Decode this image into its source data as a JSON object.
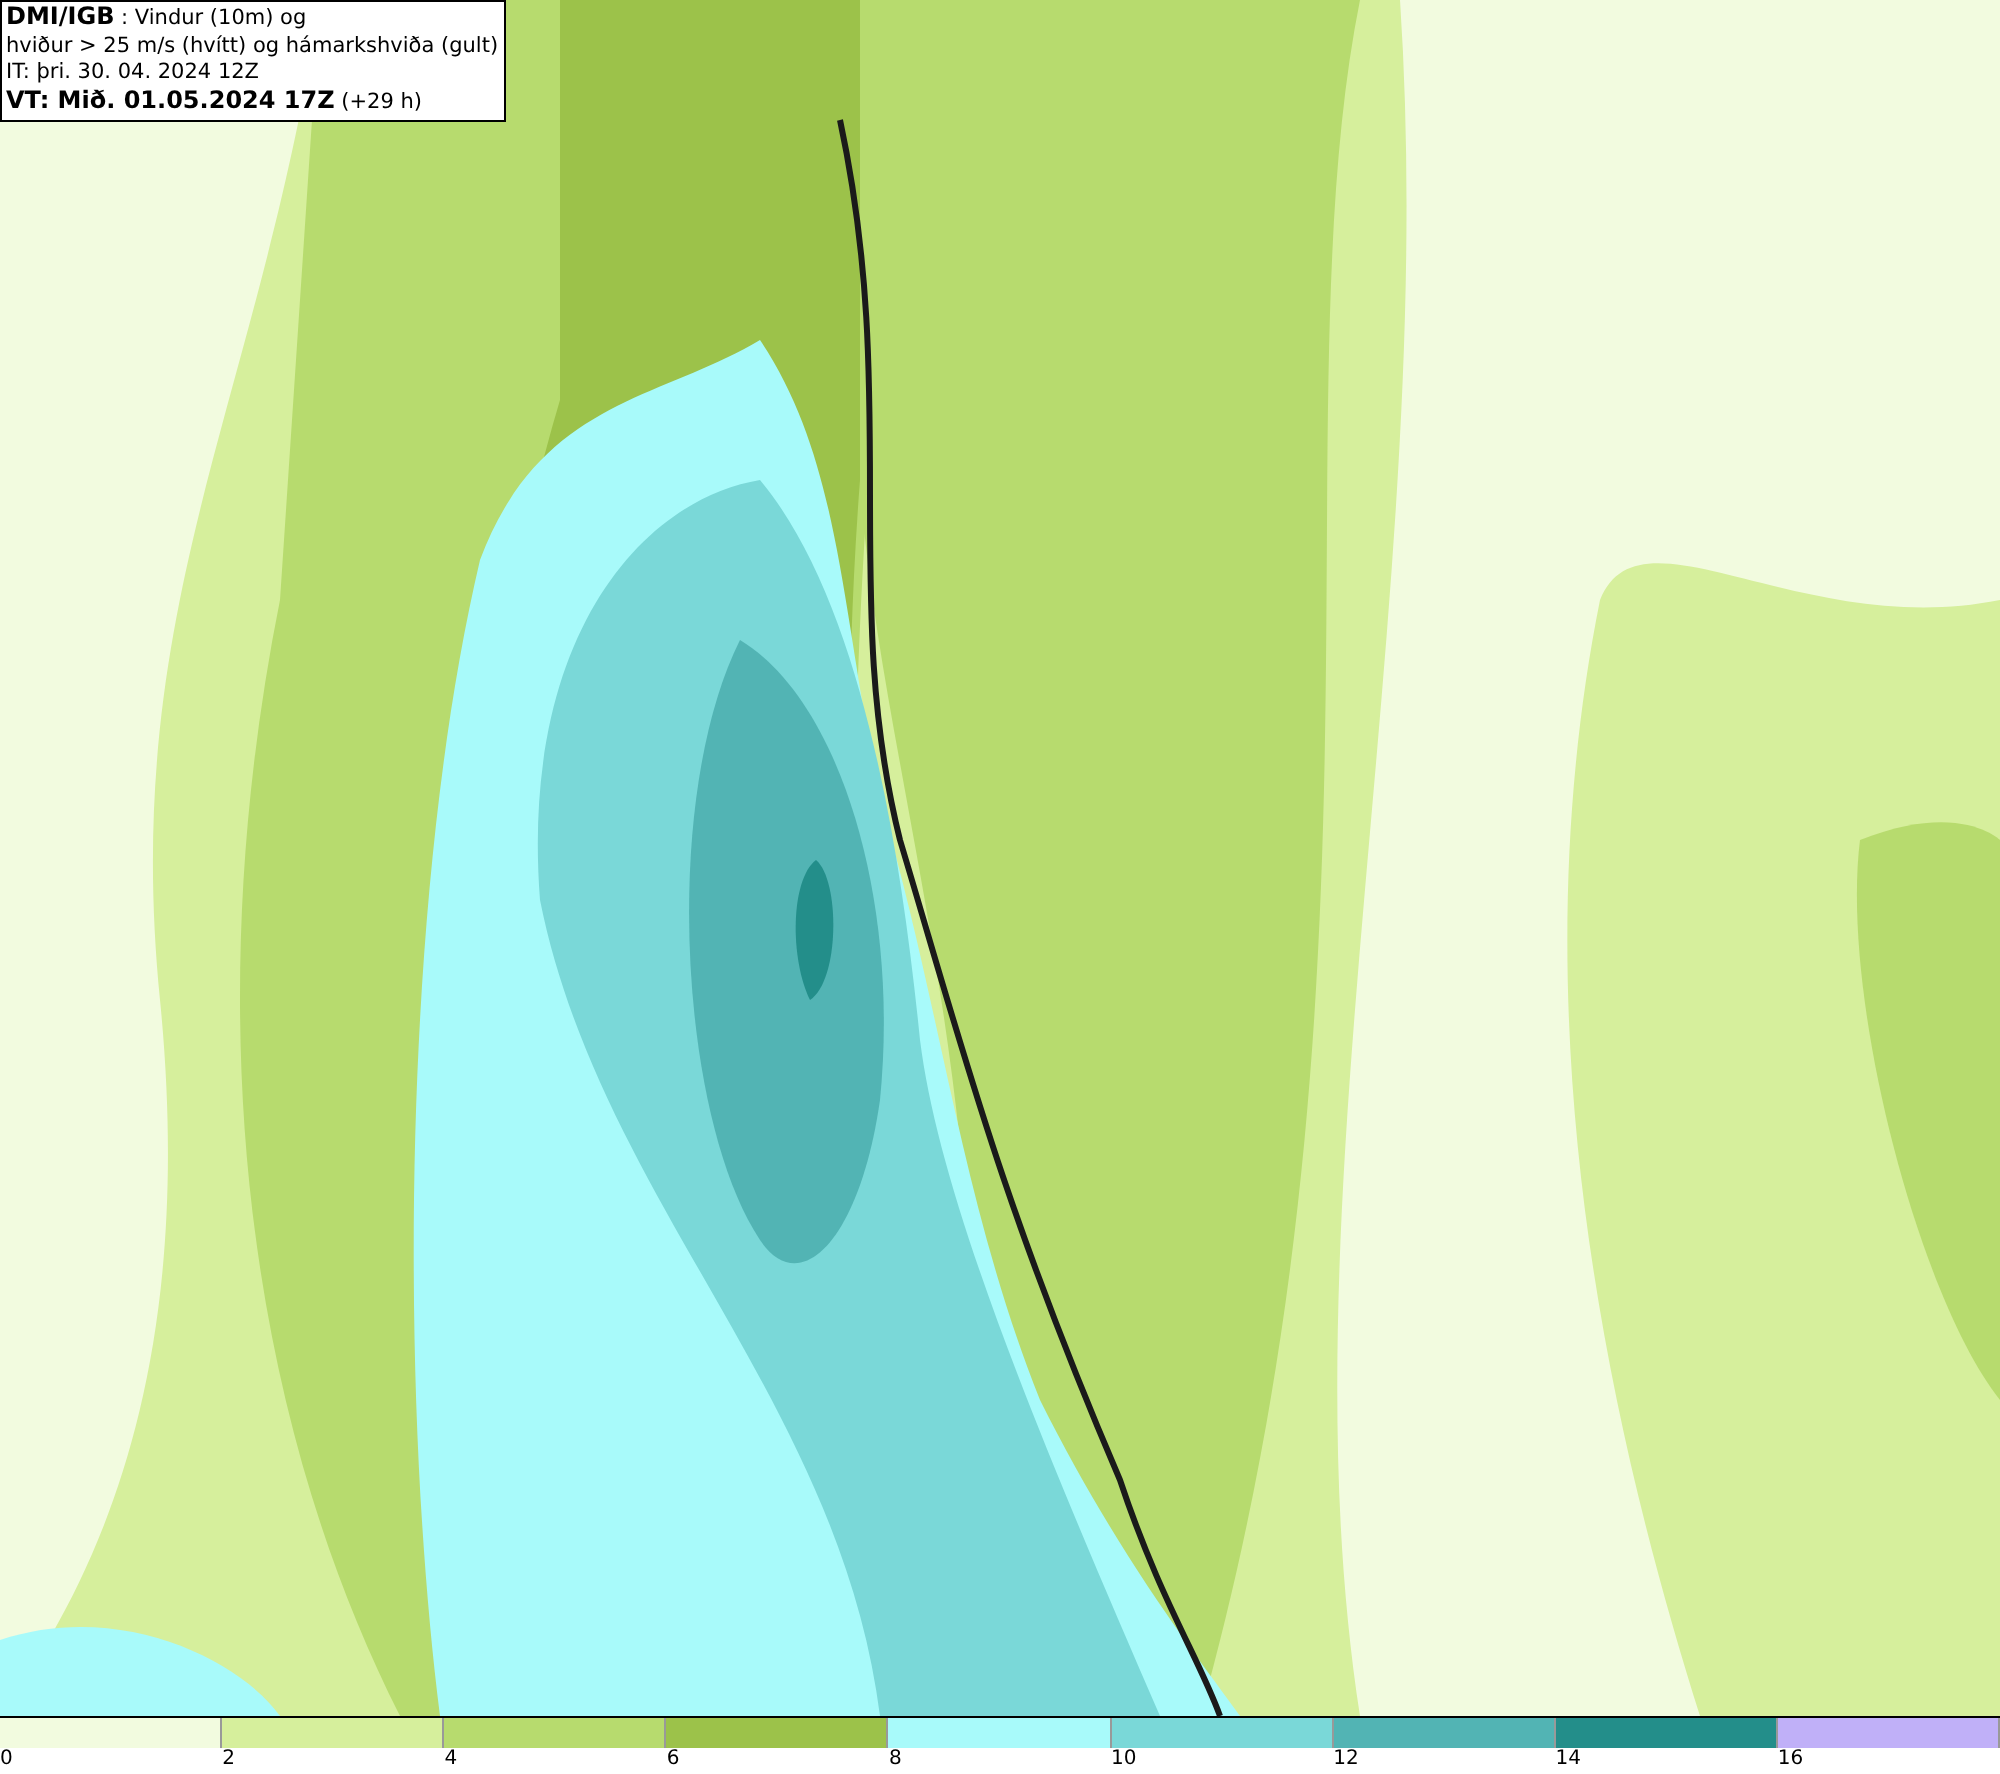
{
  "header": {
    "title": "DMI/IGB",
    "title_rest": " : Vindur (10m) og",
    "line_2": "hviður > 25 m/s (hvítt) og hámarkshviða (gult)",
    "line_3": "IT: þri. 30. 04. 2024 12Z",
    "valid_bold": "VT: Mið. 01.05.2024 17Z",
    "valid_rest": " (+29 h)"
  },
  "legend": [
    {
      "label": "0",
      "color": "#f2fbdf"
    },
    {
      "label": "2",
      "color": "#d6ef9c"
    },
    {
      "label": "4",
      "color": "#b7db6e"
    },
    {
      "label": "6",
      "color": "#9cc24a"
    },
    {
      "label": "8",
      "color": "#a8fafa"
    },
    {
      "label": "10",
      "color": "#7ad8d8"
    },
    {
      "label": "12",
      "color": "#52b4b4"
    },
    {
      "label": "14",
      "color": "#238e8a"
    },
    {
      "label": "16",
      "color": "#c0b0f8"
    }
  ]
}
